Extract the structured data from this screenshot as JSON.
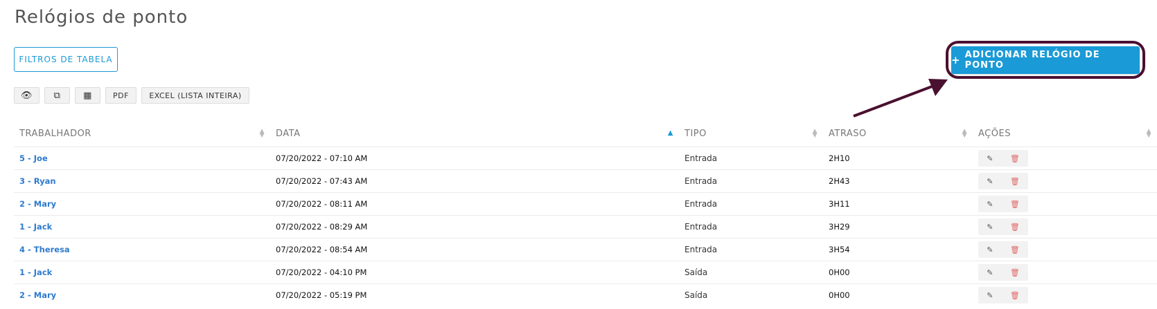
{
  "page": {
    "title": "Relógios de ponto"
  },
  "toolbar": {
    "filters_label": "FILTROS DE TABELA",
    "add_label": "ADICIONAR RELÓGIO DE PONTO",
    "add_icon": "+",
    "buttons": [
      {
        "icon": "eye-icon",
        "glyph": "👁"
      },
      {
        "icon": "copy-icon",
        "glyph": "⧉"
      },
      {
        "icon": "table-icon",
        "glyph": "▦"
      },
      {
        "label": "PDF"
      },
      {
        "label": "EXCEL (LISTA INTEIRA)"
      }
    ]
  },
  "table": {
    "columns": [
      "TRABALHADOR",
      "DATA",
      "TIPO",
      "ATRASO",
      "AÇÕES"
    ],
    "rows": [
      {
        "worker": "5 - Joe",
        "date": "07/20/2022 - 07:10 AM",
        "type": "Entrada",
        "delay": "2H10"
      },
      {
        "worker": "3 - Ryan",
        "date": "07/20/2022 - 07:43 AM",
        "type": "Entrada",
        "delay": "2H43"
      },
      {
        "worker": "2 - Mary",
        "date": "07/20/2022 - 08:11 AM",
        "type": "Entrada",
        "delay": "3H11"
      },
      {
        "worker": "1 - Jack",
        "date": "07/20/2022 - 08:29 AM",
        "type": "Entrada",
        "delay": "3H29"
      },
      {
        "worker": "4 - Theresa",
        "date": "07/20/2022 - 08:54 AM",
        "type": "Entrada",
        "delay": "3H54"
      },
      {
        "worker": "1 - Jack",
        "date": "07/20/2022 - 04:10 PM",
        "type": "Saída",
        "delay": "0H00"
      },
      {
        "worker": "2 - Mary",
        "date": "07/20/2022 - 05:19 PM",
        "type": "Saída",
        "delay": "0H00"
      }
    ]
  },
  "colors": {
    "accent": "#1a9ad6",
    "highlight": "#4a1030",
    "link": "#2e7bcf"
  }
}
